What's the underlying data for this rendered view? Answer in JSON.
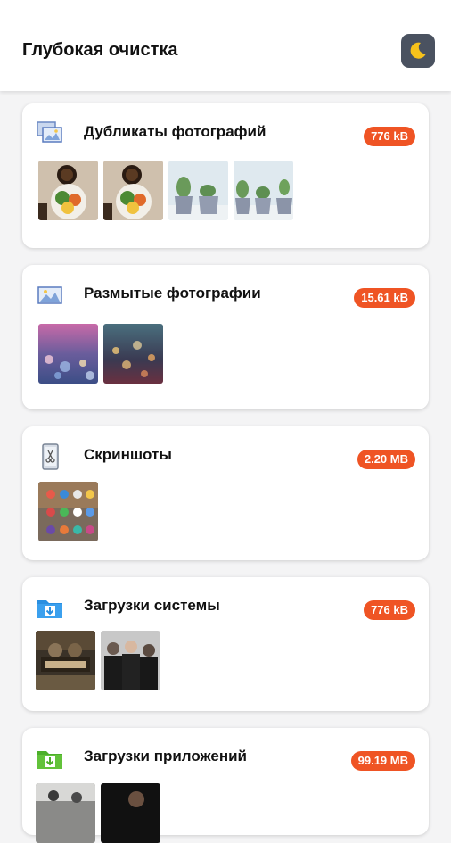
{
  "header": {
    "title": "Глубокая очистка",
    "night_mode_icon": "moon-icon"
  },
  "colors": {
    "badge": "#ef5424",
    "card": "#ffffff",
    "background": "#f4f4f5"
  },
  "cards": [
    {
      "title": "Дубликаты фотографий",
      "size": "776 kB",
      "icon": "photos-stack-icon",
      "thumbs": [
        "food-bowl-photo",
        "food-bowl-photo",
        "cactus-pots-photo",
        "cactus-pots-photo"
      ]
    },
    {
      "title": "Размытые фотографии",
      "size": "15.61 kB",
      "icon": "landscape-photo-icon",
      "thumbs": [
        "bokeh-lights-photo",
        "city-bokeh-photo"
      ]
    },
    {
      "title": "Скриншоты",
      "size": "2.20 MB",
      "icon": "phone-scissors-icon",
      "thumbs": [
        "homescreen-screenshot"
      ]
    },
    {
      "title": "Загрузки системы",
      "size": "776 kB",
      "icon": "folder-download-icon",
      "thumbs": [
        "movie-poster",
        "band-photo"
      ]
    },
    {
      "title": "Загрузки приложений",
      "size": "99.19 MB",
      "icon": "green-folder-download-icon",
      "thumbs": [
        "street-photo",
        "dark-portrait-photo"
      ]
    }
  ]
}
